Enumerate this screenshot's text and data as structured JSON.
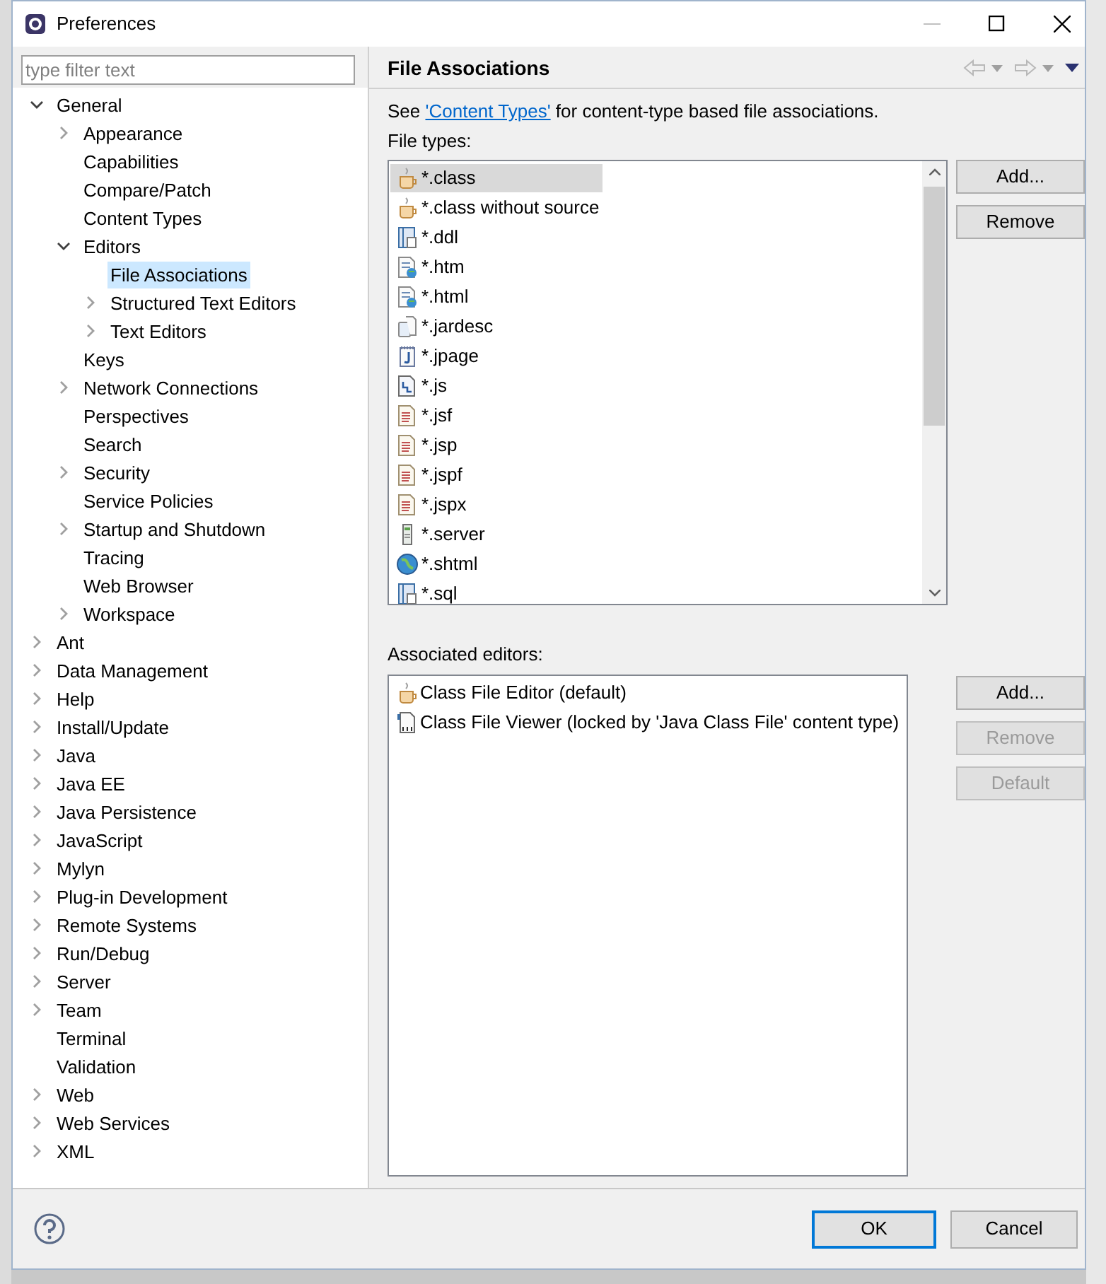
{
  "window": {
    "title": "Preferences"
  },
  "filter": {
    "placeholder": "type filter text"
  },
  "tree": [
    {
      "label": "General",
      "kind": "node",
      "expanded": true,
      "selected": false,
      "children": [
        {
          "label": "Appearance",
          "kind": "node",
          "expanded": false,
          "selected": false
        },
        {
          "label": "Capabilities",
          "kind": "leaf",
          "selected": false
        },
        {
          "label": "Compare/Patch",
          "kind": "leaf",
          "selected": false
        },
        {
          "label": "Content Types",
          "kind": "leaf",
          "selected": false
        },
        {
          "label": "Editors",
          "kind": "node",
          "expanded": true,
          "selected": false,
          "children": [
            {
              "label": "File Associations",
              "kind": "leaf",
              "selected": true
            },
            {
              "label": "Structured Text Editors",
              "kind": "node",
              "expanded": false,
              "selected": false
            },
            {
              "label": "Text Editors",
              "kind": "node",
              "expanded": false,
              "selected": false
            }
          ]
        },
        {
          "label": "Keys",
          "kind": "leaf",
          "selected": false
        },
        {
          "label": "Network Connections",
          "kind": "node",
          "expanded": false,
          "selected": false
        },
        {
          "label": "Perspectives",
          "kind": "leaf",
          "selected": false
        },
        {
          "label": "Search",
          "kind": "leaf",
          "selected": false
        },
        {
          "label": "Security",
          "kind": "node",
          "expanded": false,
          "selected": false
        },
        {
          "label": "Service Policies",
          "kind": "leaf",
          "selected": false
        },
        {
          "label": "Startup and Shutdown",
          "kind": "node",
          "expanded": false,
          "selected": false
        },
        {
          "label": "Tracing",
          "kind": "leaf",
          "selected": false
        },
        {
          "label": "Web Browser",
          "kind": "leaf",
          "selected": false
        },
        {
          "label": "Workspace",
          "kind": "node",
          "expanded": false,
          "selected": false
        }
      ]
    },
    {
      "label": "Ant",
      "kind": "node",
      "expanded": false,
      "selected": false
    },
    {
      "label": "Data Management",
      "kind": "node",
      "expanded": false,
      "selected": false
    },
    {
      "label": "Help",
      "kind": "node",
      "expanded": false,
      "selected": false
    },
    {
      "label": "Install/Update",
      "kind": "node",
      "expanded": false,
      "selected": false
    },
    {
      "label": "Java",
      "kind": "node",
      "expanded": false,
      "selected": false
    },
    {
      "label": "Java EE",
      "kind": "node",
      "expanded": false,
      "selected": false
    },
    {
      "label": "Java Persistence",
      "kind": "node",
      "expanded": false,
      "selected": false
    },
    {
      "label": "JavaScript",
      "kind": "node",
      "expanded": false,
      "selected": false
    },
    {
      "label": "Mylyn",
      "kind": "node",
      "expanded": false,
      "selected": false
    },
    {
      "label": "Plug-in Development",
      "kind": "node",
      "expanded": false,
      "selected": false
    },
    {
      "label": "Remote Systems",
      "kind": "node",
      "expanded": false,
      "selected": false
    },
    {
      "label": "Run/Debug",
      "kind": "node",
      "expanded": false,
      "selected": false
    },
    {
      "label": "Server",
      "kind": "node",
      "expanded": false,
      "selected": false
    },
    {
      "label": "Team",
      "kind": "node",
      "expanded": false,
      "selected": false
    },
    {
      "label": "Terminal",
      "kind": "leaf",
      "selected": false
    },
    {
      "label": "Validation",
      "kind": "leaf",
      "selected": false
    },
    {
      "label": "Web",
      "kind": "node",
      "expanded": false,
      "selected": false
    },
    {
      "label": "Web Services",
      "kind": "node",
      "expanded": false,
      "selected": false
    },
    {
      "label": "XML",
      "kind": "node",
      "expanded": false,
      "selected": false
    }
  ],
  "page": {
    "title": "File Associations",
    "intro": "See ",
    "link": "'Content Types'",
    "intro_rest": " for content-type based file associations.",
    "file_types_label": "File types:",
    "file_types": [
      {
        "name": "*.class",
        "kind": "cup",
        "selected": true
      },
      {
        "name": "*.class without source",
        "kind": "cup",
        "selected": false
      },
      {
        "name": "*.ddl",
        "kind": "db",
        "selected": false
      },
      {
        "name": "*.htm",
        "kind": "web",
        "selected": false
      },
      {
        "name": "*.html",
        "kind": "web",
        "selected": false
      },
      {
        "name": "*.jardesc",
        "kind": "jar",
        "selected": false
      },
      {
        "name": "*.jpage",
        "kind": "jpage",
        "selected": false
      },
      {
        "name": "*.js",
        "kind": "js",
        "selected": false
      },
      {
        "name": "*.jsf",
        "kind": "doc",
        "selected": false
      },
      {
        "name": "*.jsp",
        "kind": "doc",
        "selected": false
      },
      {
        "name": "*.jspf",
        "kind": "doc",
        "selected": false
      },
      {
        "name": "*.jspx",
        "kind": "doc",
        "selected": false
      },
      {
        "name": "*.server",
        "kind": "server",
        "selected": false
      },
      {
        "name": "*.shtml",
        "kind": "globe",
        "selected": false
      },
      {
        "name": "*.sql",
        "kind": "db",
        "selected": false
      }
    ],
    "file_type_buttons": [
      {
        "label": "Add...",
        "disabled": false
      },
      {
        "label": "Remove",
        "disabled": false
      }
    ],
    "editors_label": "Associated editors:",
    "editors": [
      {
        "name": "Class File Editor (default)",
        "kind": "cup"
      },
      {
        "name": "Class File Viewer (locked by 'Java Class File' content type)",
        "kind": "binary"
      }
    ],
    "editor_buttons": [
      {
        "label": "Add...",
        "disabled": false
      },
      {
        "label": "Remove",
        "disabled": true
      },
      {
        "label": "Default",
        "disabled": true
      }
    ]
  },
  "buttons": [
    {
      "label": "OK",
      "default": true
    },
    {
      "label": "Cancel",
      "default": false
    }
  ]
}
